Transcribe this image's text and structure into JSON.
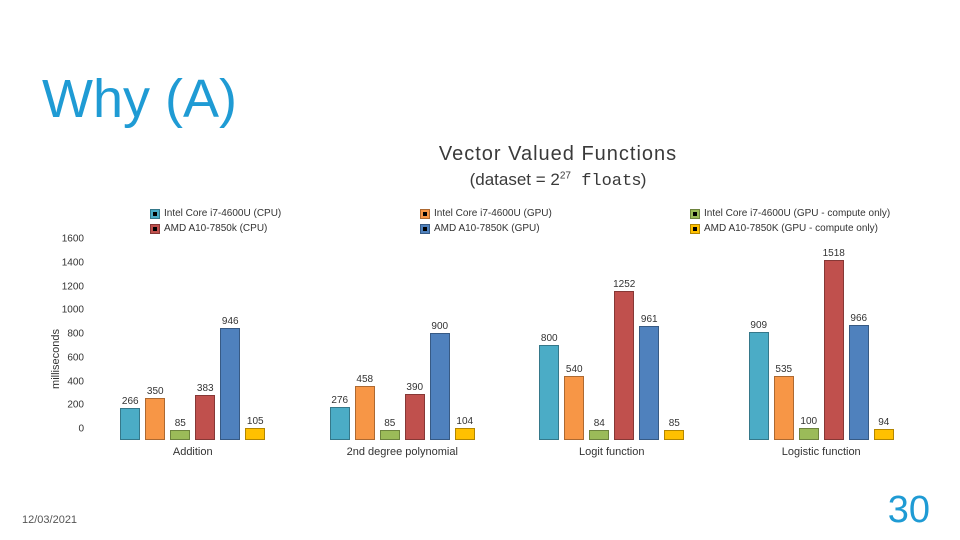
{
  "title": "Why (A)",
  "subtitle_line1": "Vector Valued Functions",
  "subtitle_line2_prefix": "(dataset = 2",
  "subtitle_line2_exp": "27",
  "subtitle_line2_suffix_mono": " float",
  "subtitle_line2_suffix": "s)",
  "date": "12/03/2021",
  "page": "30",
  "legend": {
    "s0": "Intel Core i7-4600U (CPU)",
    "s1": "Intel Core i7-4600U (GPU)",
    "s2": "Intel Core i7-4600U (GPU - compute only)",
    "s3": "AMD A10-7850k (CPU)",
    "s4": "AMD A10-7850K (GPU)",
    "s5": "AMD A10-7850K (GPU - compute only)"
  },
  "chart_data": {
    "type": "bar",
    "ylabel": "milliseconds",
    "ylim": [
      0,
      1600
    ],
    "yticks": [
      0,
      200,
      400,
      600,
      800,
      1000,
      1200,
      1400,
      1600
    ],
    "categories": [
      "Addition",
      "2nd degree polynomial",
      "Logit function",
      "Logistic function"
    ],
    "series": [
      {
        "name": "Intel Core i7-4600U (CPU)",
        "color": "#4bacc6",
        "values": [
          266,
          276,
          800,
          909
        ]
      },
      {
        "name": "Intel Core i7-4600U (GPU)",
        "color": "#f79646",
        "values": [
          350,
          458,
          540,
          535
        ]
      },
      {
        "name": "Intel Core i7-4600U (GPU - compute only)",
        "color": "#9bbb59",
        "values": [
          85,
          85,
          84,
          100
        ]
      },
      {
        "name": "AMD A10-7850k (CPU)",
        "color": "#c0504d",
        "values": [
          383,
          390,
          1252,
          1518
        ]
      },
      {
        "name": "AMD A10-7850K (GPU)",
        "color": "#4f81bd",
        "values": [
          946,
          900,
          961,
          966
        ]
      },
      {
        "name": "AMD A10-7850K (GPU - compute only)",
        "color": "#ffc000",
        "values": [
          105,
          104,
          85,
          94
        ]
      }
    ]
  }
}
